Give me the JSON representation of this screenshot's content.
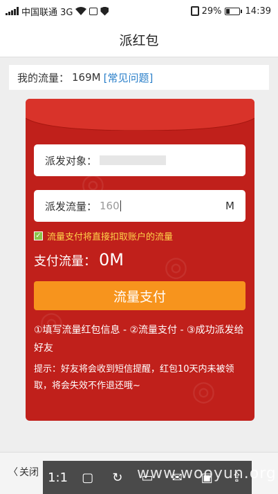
{
  "status_bar": {
    "carrier": "中国联通 3G",
    "battery": "29%",
    "time": "14:39"
  },
  "header": {
    "title": "派红包"
  },
  "quota": {
    "label": "我的流量：",
    "value": "169M",
    "faq_link": "[常见问题]"
  },
  "form": {
    "recipient_label": "派发对象：",
    "amount_label": "派发流量：",
    "amount_value": "160",
    "amount_unit": "M",
    "checkbox_label": "流量支付将直接扣取账户的流量",
    "checkbox_checked": true,
    "pay_label": "支付流量：",
    "pay_amount": "0M",
    "pay_button": "流量支付"
  },
  "steps_text": "①填写流量红包信息 - ②流量支付 - ③成功派发给好友",
  "tip_text": "提示：好友将会收到短信提醒，红包10天内未被领取，将会失效不作退还哦~",
  "bottom_bar": {
    "close_label": "关闭",
    "zoom_label": "1:1",
    "watermark": "www.wooyun.org"
  },
  "colors": {
    "envelope": "#c0201b",
    "button": "#f7941d",
    "link": "#2a7fc9",
    "checkbox_text": "#ffd34a"
  }
}
